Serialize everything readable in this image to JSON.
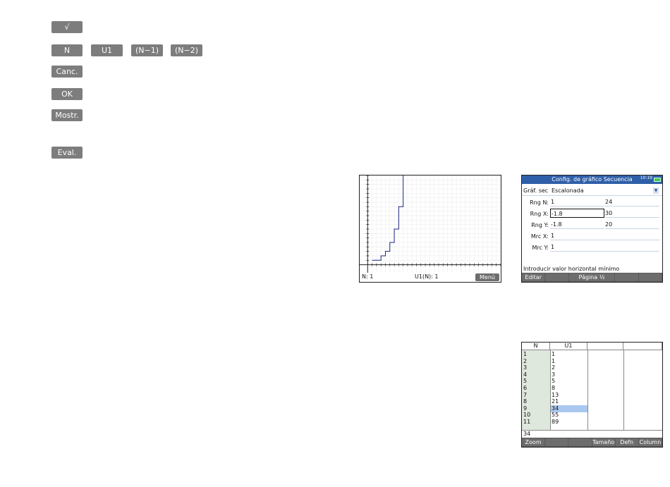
{
  "softkeys": {
    "sqrt": "√",
    "n": "N",
    "u1": "U1",
    "n_minus_1": "(N−1)",
    "n_minus_2": "(N−2)",
    "cancel": "Canc.",
    "ok": "OK",
    "show": "Mostr.",
    "eval": "Eval."
  },
  "plot_screen": {
    "status_n": "N: 1",
    "status_u1": "U1(N): 1",
    "menu_label": "Menú",
    "staircase_values": [
      1,
      1,
      2,
      3,
      5,
      8,
      13,
      21,
      34
    ],
    "x_range": [
      -1.8,
      30
    ],
    "y_range": [
      -1.8,
      20
    ]
  },
  "setup_screen": {
    "title": "Config. de gráfico Secuencia",
    "time": "10:19",
    "graph_label": "Gráf. sec",
    "graph_value": "Escalonada",
    "rows": [
      {
        "label": "Rng N:",
        "min": "1",
        "max": "24"
      },
      {
        "label": "Rng X:",
        "min": "-1.8",
        "max": "30"
      },
      {
        "label": "Rng Y:",
        "min": "-1.8",
        "max": "20"
      },
      {
        "label": "Mrc X:",
        "min": "1"
      },
      {
        "label": "Mrc Y:",
        "min": "1"
      }
    ],
    "help": "Introducir valor horizontal mínimo",
    "menu": [
      "Editar",
      "",
      "Página ½",
      "",
      ""
    ]
  },
  "table_screen": {
    "headers": [
      "N",
      "U1",
      "",
      ""
    ],
    "rows": [
      [
        "1",
        "1"
      ],
      [
        "2",
        "1"
      ],
      [
        "3",
        "2"
      ],
      [
        "4",
        "3"
      ],
      [
        "5",
        "5"
      ],
      [
        "6",
        "8"
      ],
      [
        "7",
        "13"
      ],
      [
        "8",
        "21"
      ],
      [
        "9",
        "34"
      ],
      [
        "10",
        "55"
      ],
      [
        "11",
        "89"
      ]
    ],
    "selected_row": 8,
    "entry": "34",
    "menu": [
      "Zoom",
      "",
      "",
      "Tamaño",
      "Defn",
      "Column"
    ]
  },
  "colors": {
    "softkey": "#7d7d7d",
    "title_bar": "#2f5fa8",
    "plot_line": "#1a237e",
    "selection": "#a9c8f0",
    "column_highlight": "#dfe8dc"
  }
}
